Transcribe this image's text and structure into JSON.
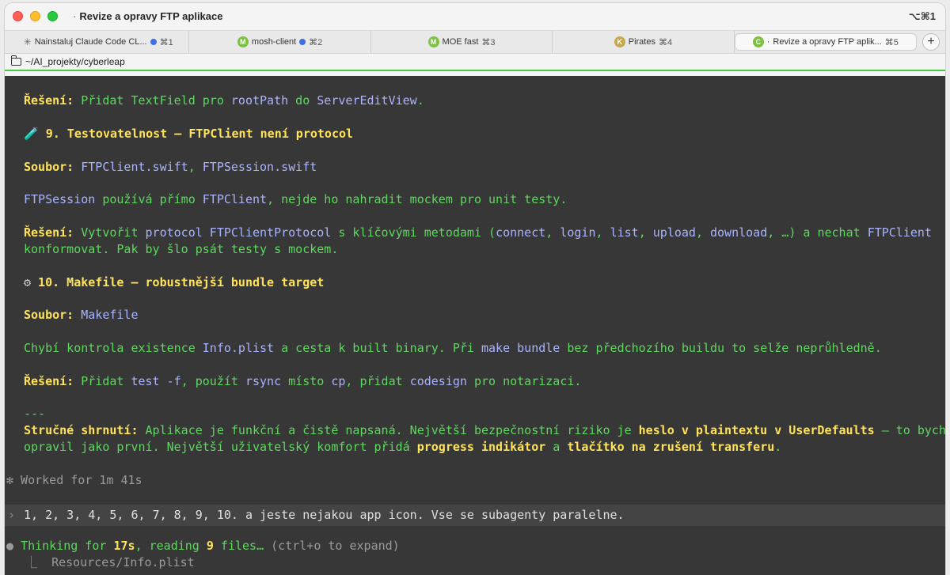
{
  "window": {
    "title": "Revize a opravy FTP aplikace",
    "title_prefix": "·",
    "shortcut": "⌥⌘1"
  },
  "tabs": [
    {
      "label": "Nainstaluj Claude Code CL...",
      "prefix": "✳",
      "kbd": "⌘1",
      "dot": true
    },
    {
      "label": "mosh-client",
      "badge": "M",
      "badge_color": "#7cc142",
      "kbd": "⌘2",
      "dot": true
    },
    {
      "label": "MOE fast",
      "badge": "M",
      "badge_color": "#7cc142",
      "kbd": "⌘3",
      "dot": false
    },
    {
      "label": "Pirates",
      "badge": "K",
      "badge_color": "#c8a94a",
      "kbd": "⌘4",
      "dot": false
    },
    {
      "label": "Revize a opravy FTP aplik...",
      "badge": "C",
      "badge_color": "#7cc142",
      "prefix": "·",
      "kbd": "⌘5",
      "dot": false
    }
  ],
  "add_tab": "+",
  "path": "~/AI_projekty/cyberleap",
  "terminal": {
    "l1_label": "Řešení:",
    "l1_a": " Přidat TextField pro ",
    "l1_b": "rootPath",
    "l1_c": " do ",
    "l1_d": "ServerEditView",
    "l1_e": ".",
    "h9_icon": "🧪",
    "h9": " 9. Testovatelnost — FTPClient není protocol",
    "l3_label": "Soubor:",
    "l3_a": " FTPClient.swift",
    "l3_b": ",",
    "l3_c": " FTPSession.swift",
    "l4_a": "FTPSession",
    "l4_b": " používá přímo ",
    "l4_c": "FTPClient",
    "l4_d": ", nejde ho nahradit mockem pro unit testy.",
    "l5_label": "Řešení:",
    "l5_a": " Vytvořit ",
    "l5_b": "protocol FTPClientProtocol",
    "l5_c": " s klíčovými metodami (",
    "l5_d": "connect",
    "l5_e": ", ",
    "l5_f": "login",
    "l5_g": ", ",
    "l5_h": "list",
    "l5_i": ", ",
    "l5_j": "upload",
    "l5_k": ", ",
    "l5_l": "download",
    "l5_m": ", …) a nechat ",
    "l5_n": "FTPClient",
    "l6": "konformovat. Pak by šlo psát testy s mockem.",
    "h10_icon": "⚙",
    "h10": " 10. Makefile — robustnější bundle target",
    "l8_label": "Soubor:",
    "l8_a": " Makefile",
    "l9_a": "Chybí kontrola existence ",
    "l9_b": "Info.plist",
    "l9_c": " a cesta k built binary. Při ",
    "l9_d": "make bundle",
    "l9_e": " bez předchozího buildu to selže neprůhledně.",
    "l10_label": "Řešení:",
    "l10_a": " Přidat ",
    "l10_b": "test -f",
    "l10_c": ", použít ",
    "l10_d": "rsync",
    "l10_e": " místo ",
    "l10_f": "cp",
    "l10_g": ", přidat ",
    "l10_h": "codesign",
    "l10_i": " pro notarizaci.",
    "hr": "---",
    "s1_label": "Stručné shrnutí:",
    "s1_a": " Aplikace je funkční a čistě napsaná. Největší bezpečnostní riziko je ",
    "s1_b": "heslo v plaintextu v UserDefaults",
    "s1_c": " — to bych",
    "s2_a": "opravil jako první. Největší uživatelský komfort přidá ",
    "s2_b": "progress indikátor",
    "s2_c": " a ",
    "s2_d": "tlačítko na zrušení transferu",
    "s2_e": ".",
    "worked": "✻ Worked for 1m 41s",
    "prompt_chevron": "›",
    "prompt": "1, 2, 3, 4, 5, 6, 7, 8, 9, 10. a jeste nejakou app icon. Vse se subagenty paralelne.",
    "thinking_bullet": "●",
    "thinking_a": " Thinking for ",
    "thinking_b": "17s",
    "thinking_c": ", reading ",
    "thinking_d": "9",
    "thinking_e": " files… ",
    "thinking_f": "(ctrl+o to expand)",
    "sub_prefix": "⎿",
    "sub": "  Resources/Info.plist"
  }
}
